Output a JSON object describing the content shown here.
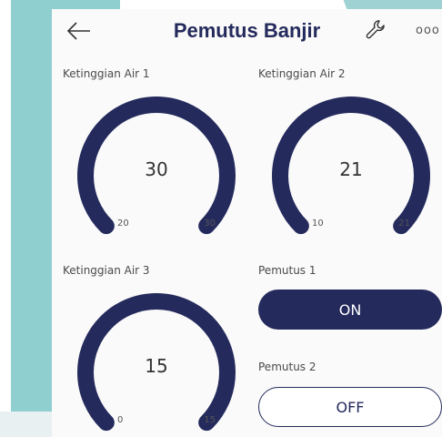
{
  "header": {
    "title": "Pemutus Banjir",
    "more": "ooo"
  },
  "gauges": [
    {
      "label": "Ketinggian Air 1",
      "value": "30",
      "min": "20",
      "max": "30",
      "level": 1.0
    },
    {
      "label": "Ketinggian Air 2",
      "value": "21",
      "min": "10",
      "max": "21",
      "level": 1.0
    },
    {
      "label": "Ketinggian Air 3",
      "value": "15",
      "min": "0",
      "max": "15",
      "level": 1.0
    }
  ],
  "switches": [
    {
      "label": "Pemutus 1",
      "state": "ON"
    },
    {
      "label": "Pemutus 2",
      "state": "OFF"
    }
  ],
  "colors": {
    "accent": "#242a5c",
    "background": "#fafafa",
    "teal": "#8fcfcf"
  },
  "icons": {
    "back": "arrow-left-icon",
    "settings": "wrench-icon",
    "more": "more-dots-icon"
  }
}
